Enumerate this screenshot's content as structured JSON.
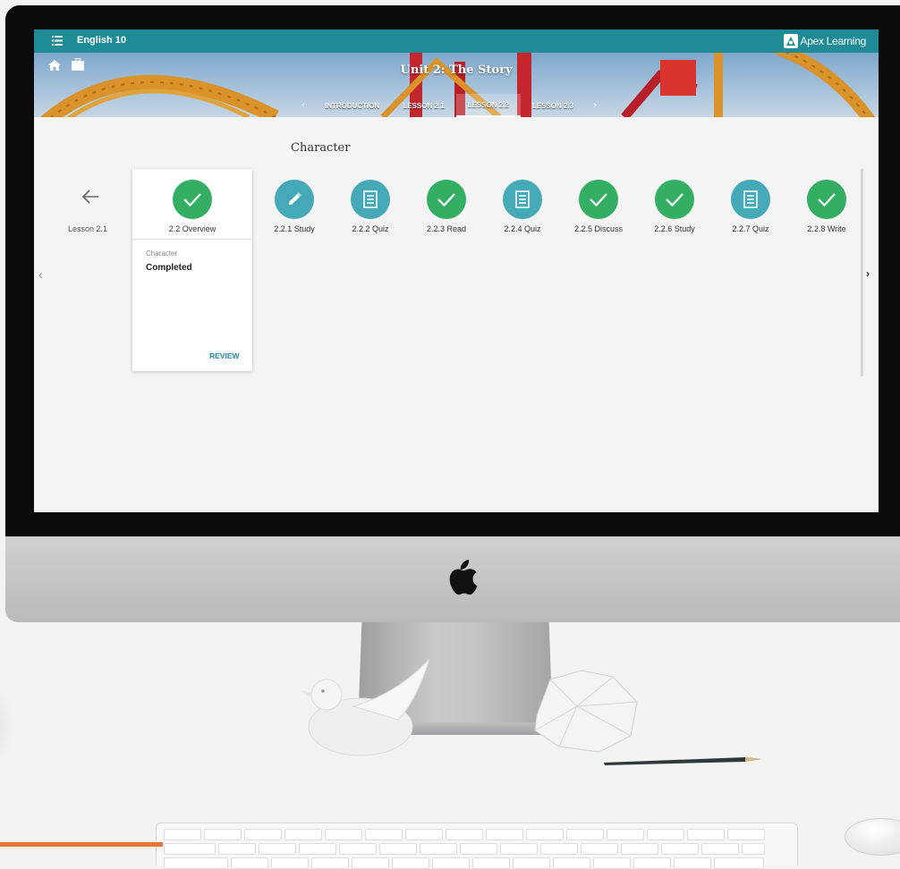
{
  "app": {
    "course_title": "English 10",
    "brand_name": "Apex Learning"
  },
  "banner": {
    "unit_title": "Unit 2: The Story",
    "tabs": [
      {
        "label": "INTRODUCTION",
        "active": false
      },
      {
        "label": "LESSON 2.1",
        "active": false
      },
      {
        "label": "LESSON 2.2",
        "active": true
      },
      {
        "label": "LESSON 2.3",
        "active": false
      }
    ]
  },
  "lesson": {
    "section_title": "Character",
    "back_label": "Lesson 2.1",
    "overview_card": {
      "label": "2.2 Overview",
      "subtitle": "Character",
      "status": "Completed",
      "review_label": "REVIEW"
    },
    "activities": [
      {
        "label": "2.2.1 Study",
        "icon": "pencil-icon",
        "state": "in-progress"
      },
      {
        "label": "2.2.2 Quiz",
        "icon": "quiz-icon",
        "state": "pending"
      },
      {
        "label": "2.2.3 Read",
        "icon": "check-icon",
        "state": "completed"
      },
      {
        "label": "2.2.4 Quiz",
        "icon": "quiz-icon",
        "state": "pending"
      },
      {
        "label": "2.2.5 Discuss",
        "icon": "check-icon",
        "state": "completed"
      },
      {
        "label": "2.2.6 Study",
        "icon": "check-icon",
        "state": "completed"
      },
      {
        "label": "2.2.7 Quiz",
        "icon": "quiz-icon",
        "state": "pending"
      },
      {
        "label": "2.2.8 Write",
        "icon": "check-icon",
        "state": "completed"
      }
    ]
  },
  "colors": {
    "topbar": "#1f8b97",
    "completed": "#33ae62",
    "pending": "#45a9b8",
    "accent_line": "#e8763b"
  }
}
